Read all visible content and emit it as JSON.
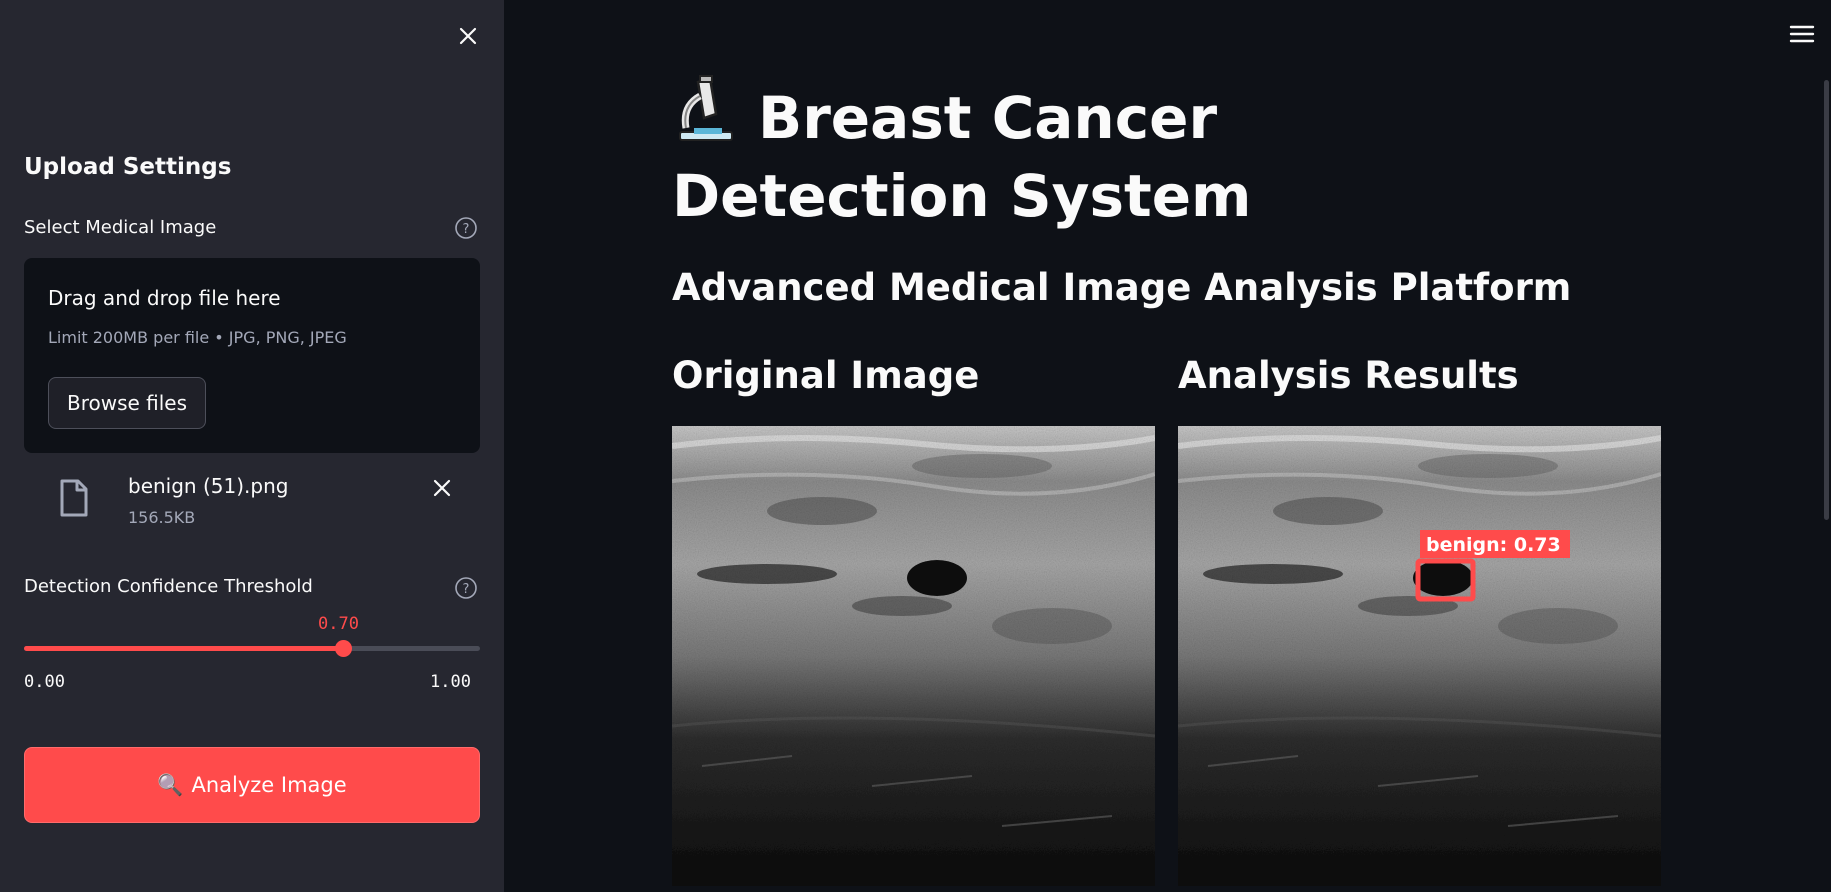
{
  "sidebar": {
    "title": "Upload Settings",
    "upload": {
      "label": "Select Medical Image",
      "dropzone_title": "Drag and drop file here",
      "dropzone_limit": "Limit 200MB per file • JPG, PNG, JPEG",
      "browse_label": "Browse files",
      "file": {
        "name": "benign (51).png",
        "size": "156.5KB"
      }
    },
    "threshold": {
      "label": "Detection Confidence Threshold",
      "value": 0.7,
      "value_display": "0.70",
      "min": "0.00",
      "max": "1.00"
    },
    "analyze_button": {
      "icon": "🔍",
      "label": "Analyze Image"
    }
  },
  "main": {
    "title": "Breast Cancer Detection System",
    "title_icon": "microscope-icon",
    "subtitle": "Advanced Medical Image Analysis Platform",
    "original_heading": "Original Image",
    "results_heading": "Analysis Results",
    "detection": {
      "label": "benign: 0.73"
    }
  },
  "colors": {
    "accent": "#ff4b4b",
    "background": "#0e1117",
    "sidebar": "#262730"
  }
}
